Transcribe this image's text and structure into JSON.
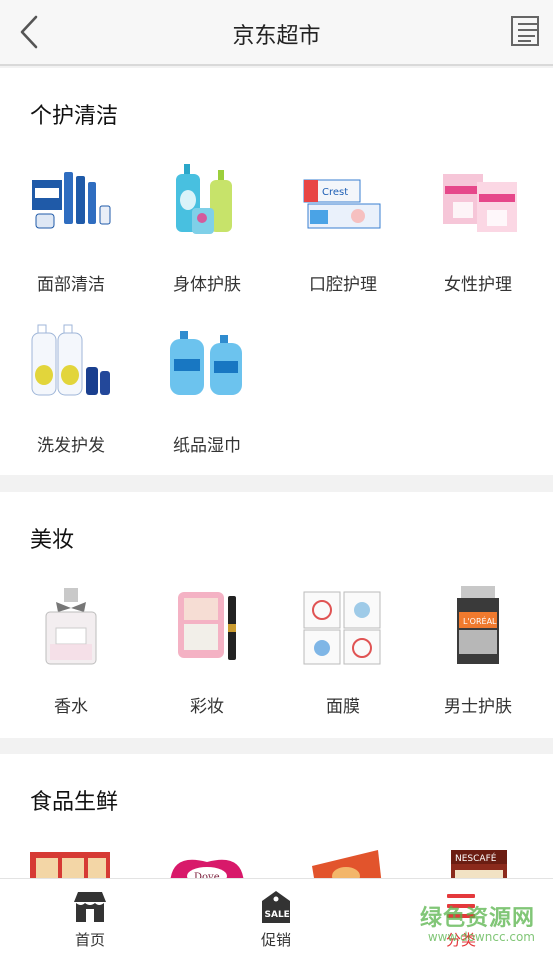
{
  "header": {
    "title": "京东超市",
    "back_icon": "chevron-left-icon",
    "menu_icon": "list-menu-icon"
  },
  "sections": [
    {
      "title": "个护清洁",
      "items": [
        {
          "label": "面部清洁",
          "icon": "face-cleanser-bottles-icon"
        },
        {
          "label": "身体护肤",
          "icon": "body-wash-bottles-icon"
        },
        {
          "label": "口腔护理",
          "icon": "toothpaste-box-icon"
        },
        {
          "label": "女性护理",
          "icon": "sanitary-pad-packs-icon"
        },
        {
          "label": "洗发护发",
          "icon": "shampoo-bottles-icon"
        },
        {
          "label": "纸品湿巾",
          "icon": "hand-wash-bottles-icon"
        }
      ]
    },
    {
      "title": "美妆",
      "items": [
        {
          "label": "香水",
          "icon": "perfume-bottle-icon"
        },
        {
          "label": "彩妆",
          "icon": "makeup-compact-icon"
        },
        {
          "label": "面膜",
          "icon": "face-mask-sheets-icon"
        },
        {
          "label": "男士护肤",
          "icon": "men-skincare-jar-icon"
        }
      ]
    },
    {
      "title": "食品生鲜",
      "items": [
        {
          "label": "",
          "icon": "snack-gift-box-icon"
        },
        {
          "label": "",
          "icon": "dove-chocolate-icon"
        },
        {
          "label": "",
          "icon": "biscuit-pack-icon"
        },
        {
          "label": "",
          "icon": "nescafe-coffee-icon"
        }
      ]
    }
  ],
  "bottom_nav": [
    {
      "label": "首页",
      "icon": "store-icon",
      "active": false
    },
    {
      "label": "促销",
      "icon": "sale-tag-icon",
      "active": false
    },
    {
      "label": "分类",
      "icon": "category-icon",
      "active": true
    }
  ],
  "watermark": {
    "line1": "绿色资源网",
    "line2": "www.downcc.com"
  },
  "colors": {
    "accent": "#e4393c",
    "watermark": "#57b34a"
  }
}
